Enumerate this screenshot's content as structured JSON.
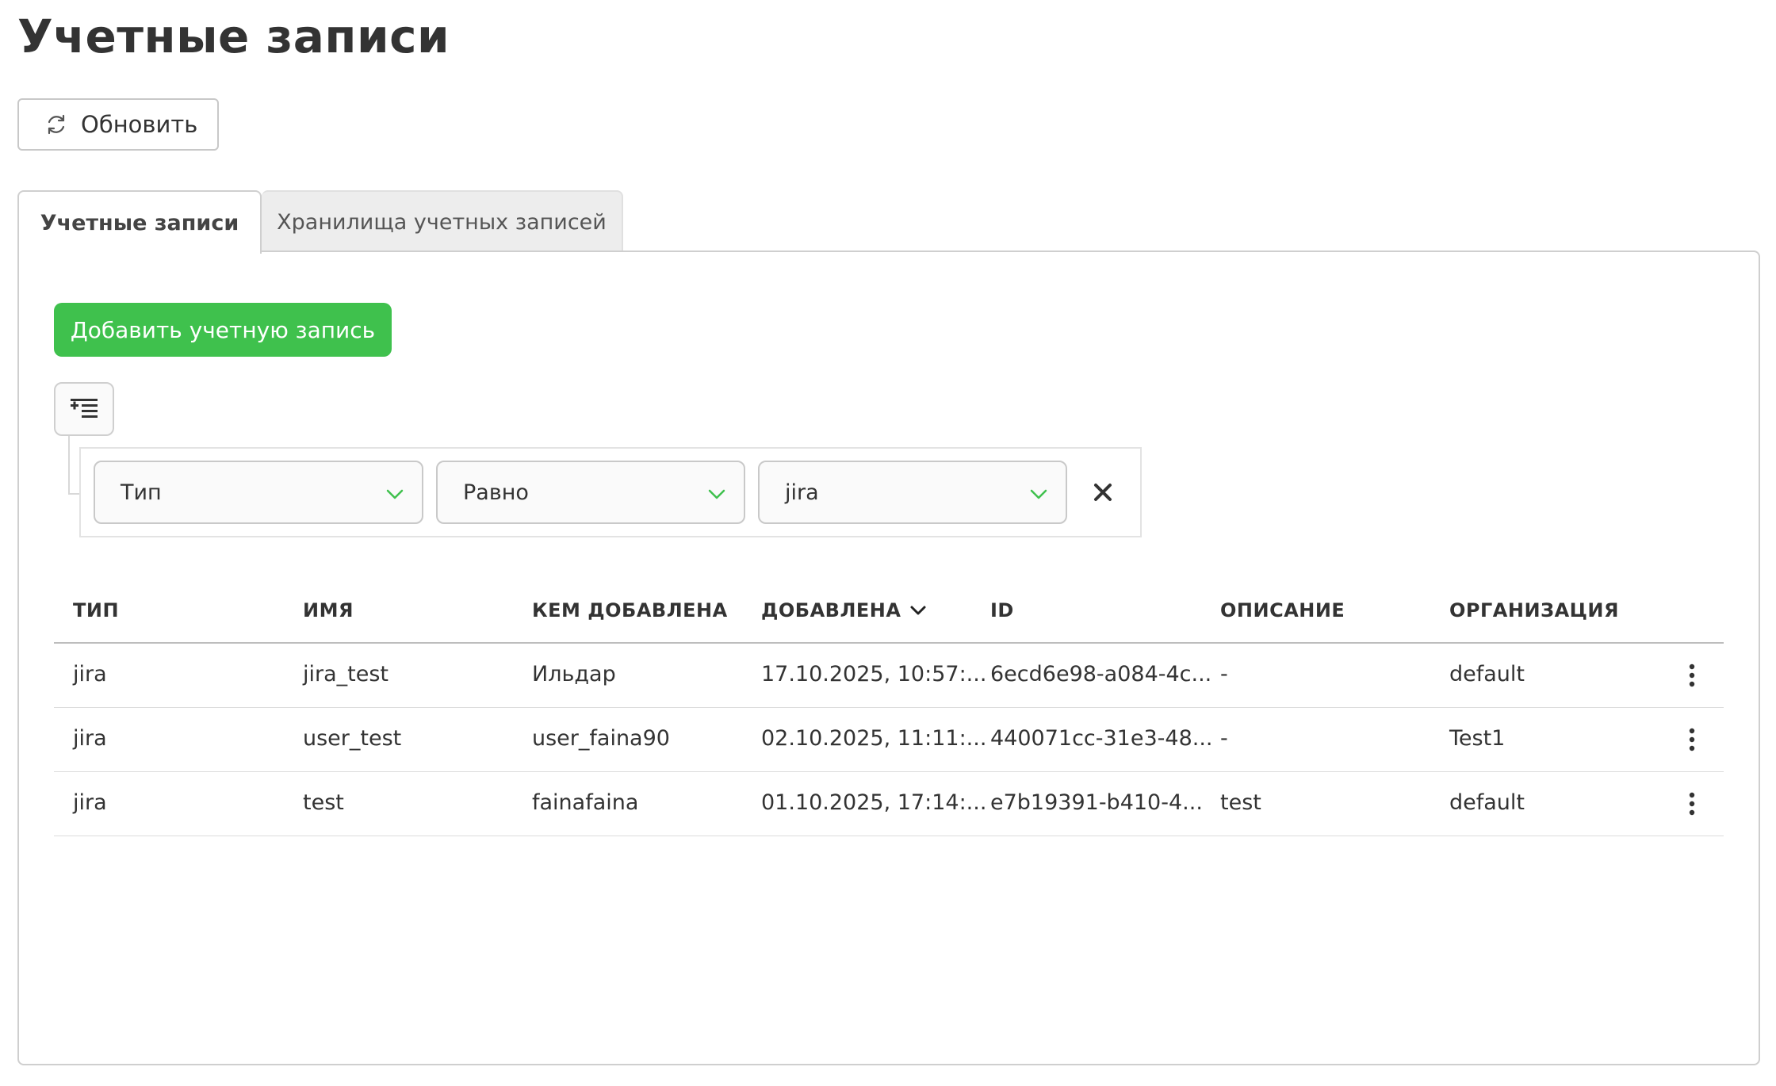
{
  "page": {
    "title": "Учетные записи"
  },
  "toolbar": {
    "refresh_label": "Обновить",
    "refresh_icon": "refresh-icon"
  },
  "tabs": [
    {
      "label": "Учетные записи",
      "active": true
    },
    {
      "label": "Хранилища учетных записей",
      "active": false
    }
  ],
  "actions": {
    "add_label": "Добавить учетную запись",
    "add_color": "#3fc14d"
  },
  "filter": {
    "toggle_icon": "filter-add-icon",
    "field": "Тип",
    "operator": "Равно",
    "value": "jira",
    "accent_color": "#3fc14d"
  },
  "table": {
    "columns": [
      "ТИП",
      "ИМЯ",
      "КЕМ ДОБАВЛЕНА",
      "ДОБАВЛЕНА",
      "ID",
      "ОПИСАНИЕ",
      "ОРГАНИЗАЦИЯ"
    ],
    "sorted_column": "ДОБАВЛЕНА",
    "sort_direction": "desc",
    "rows": [
      {
        "type": "jira",
        "name": "jira_test",
        "added_by": "Ильдар",
        "added": "17.10.2025, 10:57:...",
        "id": "6ecd6e98-a084-4c...",
        "description": "-",
        "organization": "default"
      },
      {
        "type": "jira",
        "name": "user_test",
        "added_by": "user_faina90",
        "added": "02.10.2025, 11:11:...",
        "id": "440071cc-31e3-48...",
        "description": "-",
        "organization": "Test1"
      },
      {
        "type": "jira",
        "name": "test",
        "added_by": "fainafaina",
        "added": "01.10.2025, 17:14:...",
        "id": "e7b19391-b410-4...",
        "description": "test",
        "organization": "default"
      }
    ]
  }
}
